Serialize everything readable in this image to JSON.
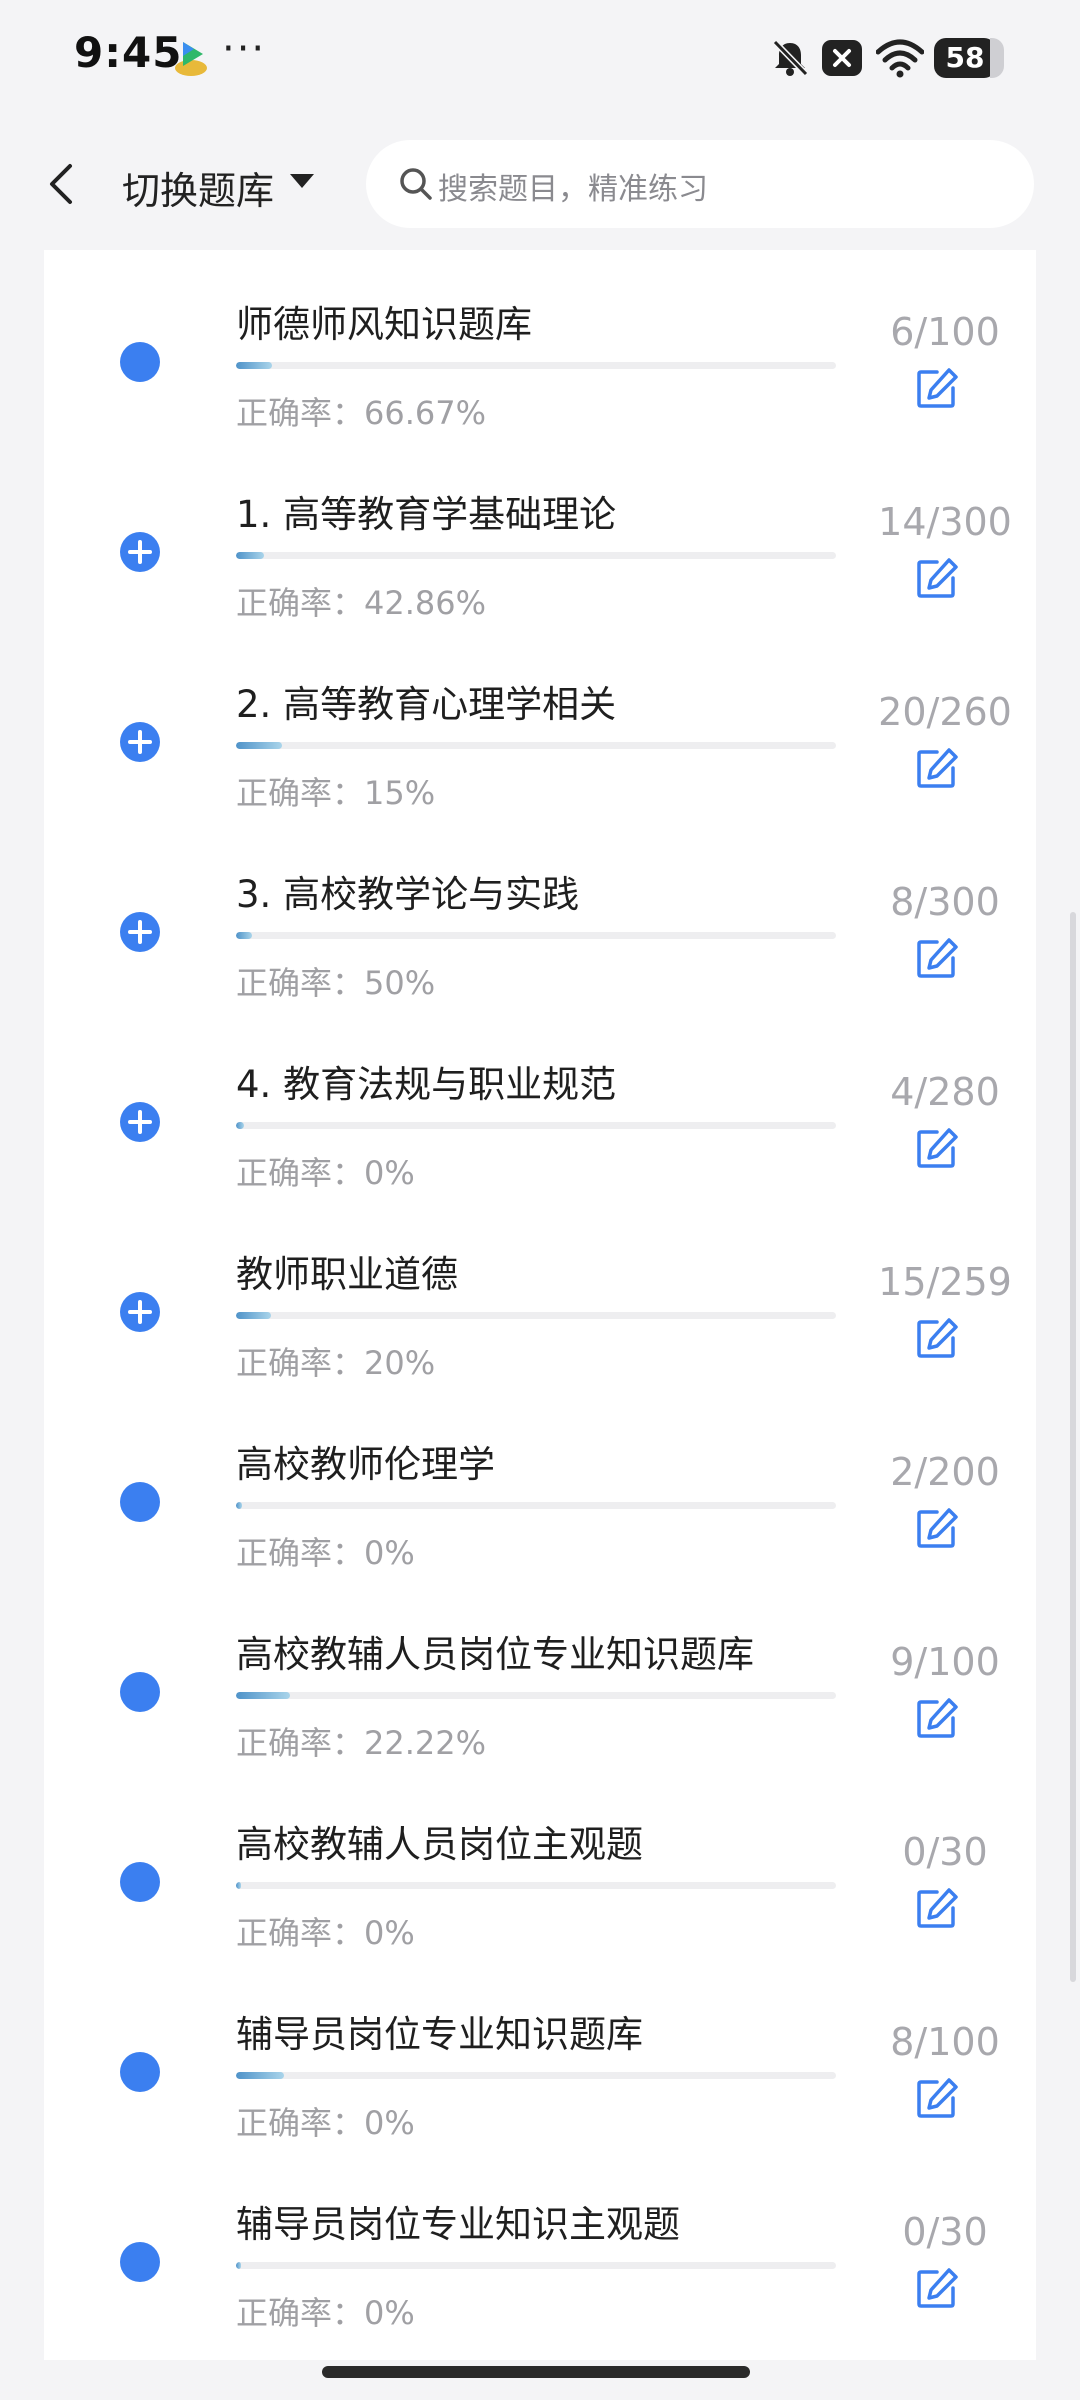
{
  "status_bar": {
    "time": "9:45",
    "more": "···",
    "battery": "58",
    "icons": [
      "app-icon",
      "bell-off-icon",
      "close-box-icon",
      "wifi-icon",
      "battery-icon"
    ]
  },
  "header": {
    "title": "切换题库",
    "search_placeholder": "搜索题目，精准练习",
    "icons": [
      "back-icon",
      "caret-down-icon",
      "search-icon"
    ]
  },
  "colors": {
    "accent": "#3b7ff0",
    "progress": "#4f93c9",
    "muted": "#a8a8ad"
  },
  "items": [
    {
      "title": "师德师风知识题库",
      "count": "6/100",
      "accuracy": "正确率：66.67%",
      "progress": 0.06,
      "expandable": false
    },
    {
      "title": "1. 高等教育学基础理论",
      "count": "14/300",
      "accuracy": "正确率：42.86%",
      "progress": 0.047,
      "expandable": true
    },
    {
      "title": "2. 高等教育心理学相关",
      "count": "20/260",
      "accuracy": "正确率：15%",
      "progress": 0.077,
      "expandable": true
    },
    {
      "title": "3. 高校教学论与实践",
      "count": "8/300",
      "accuracy": "正确率：50%",
      "progress": 0.027,
      "expandable": true
    },
    {
      "title": "4. 教育法规与职业规范",
      "count": "4/280",
      "accuracy": "正确率：0%",
      "progress": 0.014,
      "expandable": true
    },
    {
      "title": "教师职业道德",
      "count": "15/259",
      "accuracy": "正确率：20%",
      "progress": 0.058,
      "expandable": true
    },
    {
      "title": "高校教师伦理学",
      "count": "2/200",
      "accuracy": "正确率：0%",
      "progress": 0.01,
      "expandable": false
    },
    {
      "title": "高校教辅人员岗位专业知识题库",
      "count": "9/100",
      "accuracy": "正确率：22.22%",
      "progress": 0.09,
      "expandable": false
    },
    {
      "title": "高校教辅人员岗位主观题",
      "count": "0/30",
      "accuracy": "正确率：0%",
      "progress": 0,
      "expandable": false
    },
    {
      "title": "辅导员岗位专业知识题库",
      "count": "8/100",
      "accuracy": "正确率：0%",
      "progress": 0.08,
      "expandable": false
    },
    {
      "title": "辅导员岗位专业知识主观题",
      "count": "0/30",
      "accuracy": "正确率：0%",
      "progress": 0,
      "expandable": false
    }
  ]
}
